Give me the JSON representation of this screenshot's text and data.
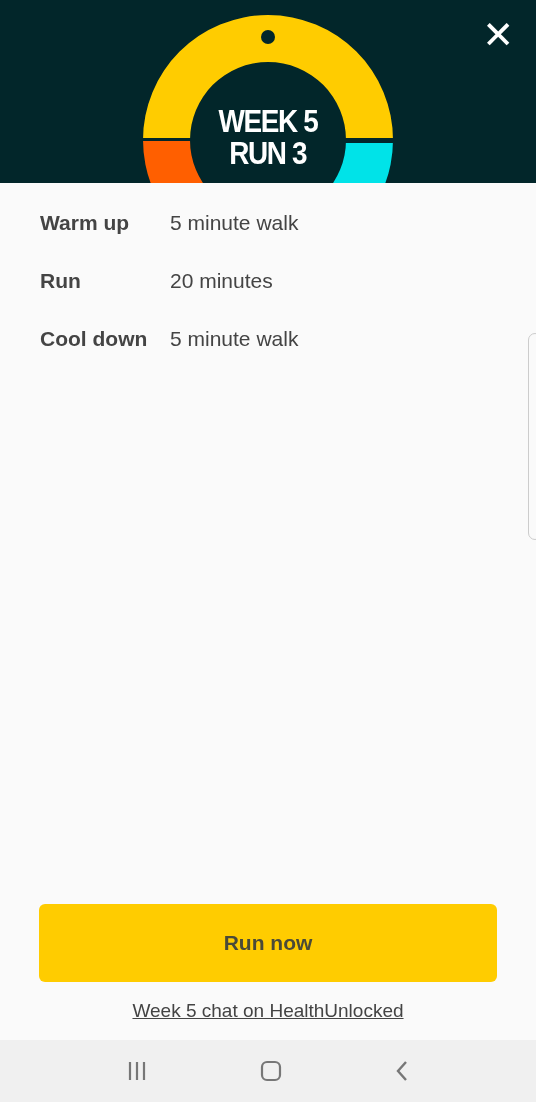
{
  "header": {
    "title_lines": [
      "WEEK 5",
      "RUN 3"
    ],
    "close": "✕"
  },
  "plan": [
    {
      "label": "Warm up",
      "value": "5 minute walk"
    },
    {
      "label": "Run",
      "value": "20 minutes"
    },
    {
      "label": "Cool down",
      "value": "5 minute walk"
    }
  ],
  "primary_button": "Run now",
  "link": "Week 5 chat on HealthUnlocked"
}
